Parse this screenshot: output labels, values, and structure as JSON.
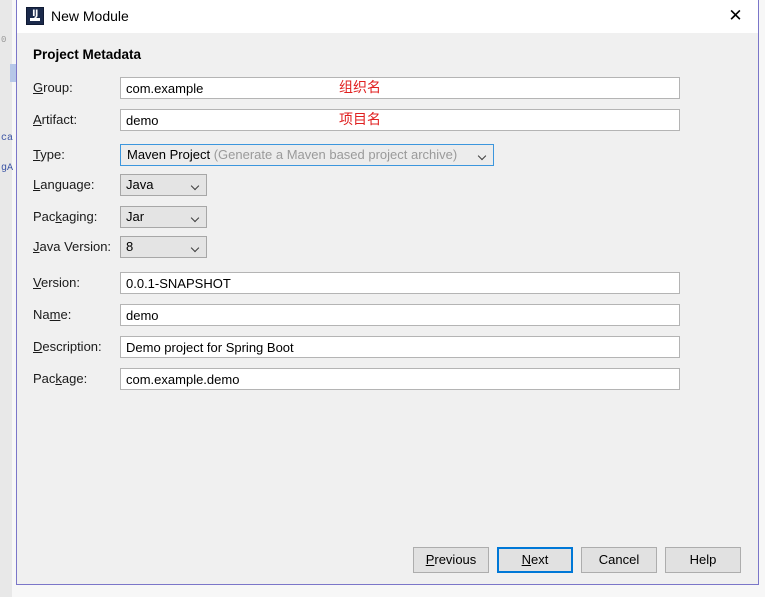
{
  "window": {
    "title": "New Module",
    "icon": "intellij-idea-icon",
    "icon_letters": "IJ",
    "close_label": "✕"
  },
  "section": {
    "title": "Project Metadata"
  },
  "form": {
    "fields": [
      {
        "label_pre": "",
        "label_key": "G",
        "label_post": "roup:",
        "value": "com.example",
        "kind": "text"
      },
      {
        "label_pre": "",
        "label_key": "A",
        "label_post": "rtifact:",
        "value": "demo",
        "kind": "text"
      },
      {
        "label_pre": "",
        "label_key": "T",
        "label_post": "ype:",
        "value": "Maven Project",
        "hint": "(Generate a Maven based project archive)",
        "kind": "combo-wide"
      },
      {
        "label_pre": "",
        "label_key": "L",
        "label_post": "anguage:",
        "value": "Java",
        "kind": "combo-small"
      },
      {
        "label_pre": "Pac",
        "label_key": "k",
        "label_post": "aging:",
        "value": "Jar",
        "kind": "combo-small"
      },
      {
        "label_pre": "",
        "label_key": "J",
        "label_post": "ava Version:",
        "value": "8",
        "kind": "combo-small"
      },
      {
        "label_pre": "",
        "label_key": "V",
        "label_post": "ersion:",
        "value": "0.0.1-SNAPSHOT",
        "kind": "text"
      },
      {
        "label_pre": "Na",
        "label_key": "m",
        "label_post": "e:",
        "value": "demo",
        "kind": "text"
      },
      {
        "label_pre": "",
        "label_key": "D",
        "label_post": "escription:",
        "value": "Demo project for Spring Boot",
        "kind": "text"
      },
      {
        "label_pre": "Pac",
        "label_key": "k",
        "label_post": "age:",
        "value": "com.example.demo",
        "kind": "text"
      }
    ]
  },
  "annotations": [
    {
      "text": "组织名",
      "color": "#e02020"
    },
    {
      "text": "项目名",
      "color": "#e02020"
    }
  ],
  "buttons": [
    {
      "label_pre": "",
      "label_key": "P",
      "label_post": "revious",
      "focused": false
    },
    {
      "label_pre": "",
      "label_key": "N",
      "label_post": "ext",
      "focused": true
    },
    {
      "label_pre": "",
      "label_key": "",
      "label_post": "Cancel",
      "focused": false
    },
    {
      "label_pre": "",
      "label_key": "",
      "label_post": "Help",
      "focused": false
    }
  ],
  "backdrop": {
    "fragments": [
      "ca",
      "gA"
    ],
    "gutter": [
      "0"
    ]
  },
  "colors": {
    "dialog_border": "#7b76c9",
    "dialog_bg": "#f0f0f0",
    "titlebar_bg": "#ffffff",
    "focus_blue": "#0078d7",
    "combo_focus_border": "#3c96dd",
    "annotation_red": "#e02020",
    "field_border": "#b4b4b4"
  }
}
